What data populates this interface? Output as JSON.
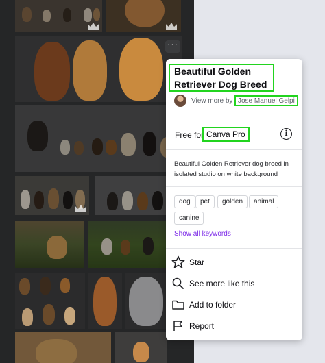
{
  "background": "#e4e6ec",
  "accent_highlight": "#22d41f",
  "more_button": {
    "label": "···"
  },
  "details": {
    "title": "Beautiful Golden Retriever Dog Breed",
    "view_more_label": "View more by",
    "author": "Jose Manuel Gelpi",
    "free_for_label": "Free for",
    "plan": "Canva Pro",
    "info_icon": "info-icon",
    "description": "Beautiful Golden Retriever dog breed in isolated studio on white background",
    "keywords": [
      "dog",
      "pet",
      "golden",
      "animal",
      "canine"
    ],
    "show_all_label": "Show all keywords",
    "link_color": "#7d2ae8"
  },
  "menu": [
    {
      "label": "Star",
      "icon": "star-icon"
    },
    {
      "label": "See more like this",
      "icon": "search-icon"
    },
    {
      "label": "Add to folder",
      "icon": "folder-icon"
    },
    {
      "label": "Report",
      "icon": "flag-icon"
    }
  ],
  "thumbnail_badge_icon": "crown-icon"
}
